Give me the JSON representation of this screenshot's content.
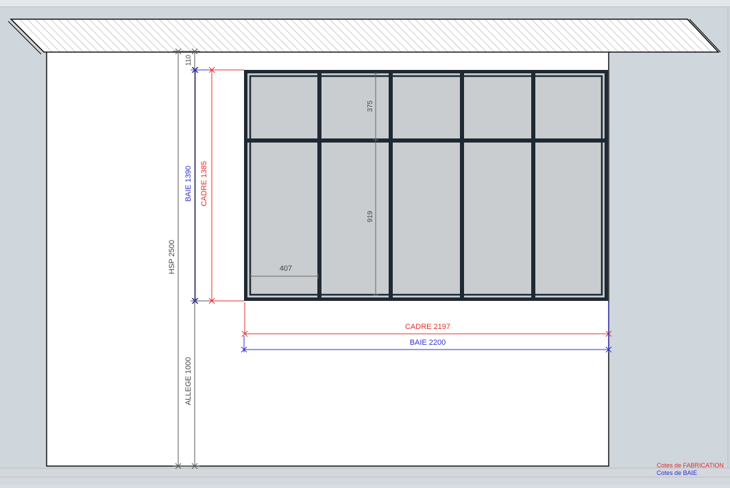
{
  "colors": {
    "background": "#cfd6dc",
    "wall": "#ffffff",
    "glass": "#c9cdd0",
    "frame": "#1f2933",
    "fabrication": "#e52d2d",
    "baie": "#2f2fd6",
    "dimension": "#555555"
  },
  "dimensions": {
    "hsp": "HSP 2500",
    "allege": "ALLEGE 1000",
    "top_gap": "110",
    "baie_height": "BAIE 1390",
    "cadre_height": "CADRE 1385",
    "cadre_width": "CADRE 2197",
    "baie_width": "BAIE 2200",
    "upper_pane": "375",
    "lower_pane": "919",
    "pane_width": "407"
  },
  "legend": {
    "fabrication": "Cotes de FABRICATION",
    "baie": "Cotes de BAIE"
  }
}
